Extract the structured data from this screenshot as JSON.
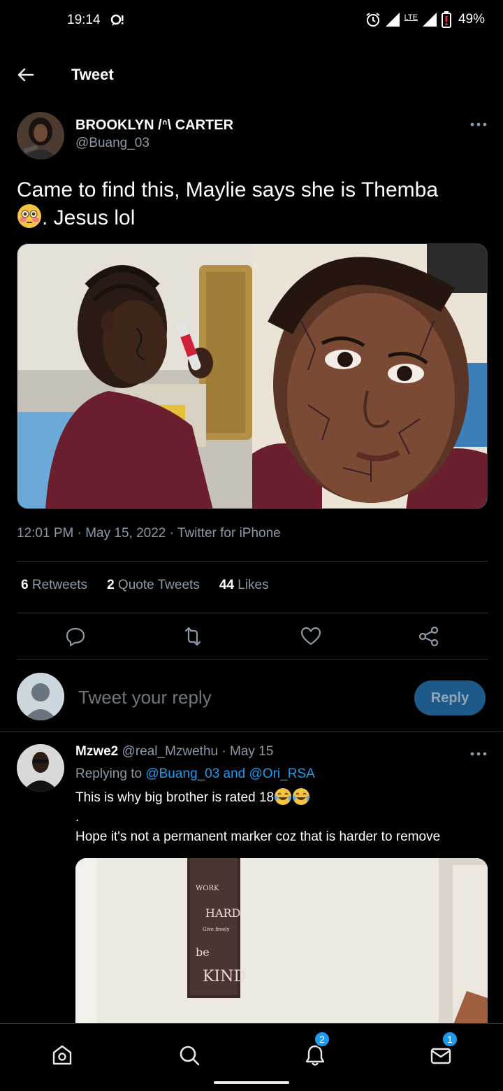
{
  "status_bar": {
    "time": "19:14",
    "network": "LTE",
    "battery": "49%",
    "icons": [
      "notification-icon",
      "alarm-icon",
      "signal-icon",
      "battery-icon"
    ]
  },
  "header": {
    "title": "Tweet",
    "back_icon": "arrow-left-icon"
  },
  "tweet": {
    "author_name": "BROOKLYN /ᐢ\\ CARTER",
    "author_handle": "@Buang_03",
    "text_part1": "Came to find this, Maylie says she is Themba",
    "text_part2": ". Jesus lol",
    "emoji": "flushed-face",
    "time": "12:01 PM",
    "date": "May 15, 2022",
    "source": "Twitter for iPhone",
    "retweets_count": "6",
    "retweets_label": "Retweets",
    "quotes_count": "2",
    "quotes_label": "Quote Tweets",
    "likes_count": "44",
    "likes_label": "Likes"
  },
  "composer": {
    "placeholder": "Tweet your reply",
    "button_label": "Reply"
  },
  "reply": {
    "name": "Mzwe2",
    "handle": "@real_Mzwethu",
    "date": "May 15",
    "replying_prefix": "Replying to",
    "replying_to": "@Buang_03 and @Ori_RSA",
    "text_line1": "This is why big brother is rated 18",
    "text_line2": ".",
    "text_line3": "Hope it's not a permanent marker coz that is harder to remove",
    "sign_lines": [
      "WORK",
      "HARD",
      "Give freely",
      "be",
      "KIND"
    ]
  },
  "bottom_nav": {
    "notifications_badge": "2",
    "messages_badge": "1"
  },
  "colors": {
    "background": "#000000",
    "accent": "#1d9bf0",
    "secondary_text": "#8b98a5",
    "divider": "#2f3336"
  }
}
